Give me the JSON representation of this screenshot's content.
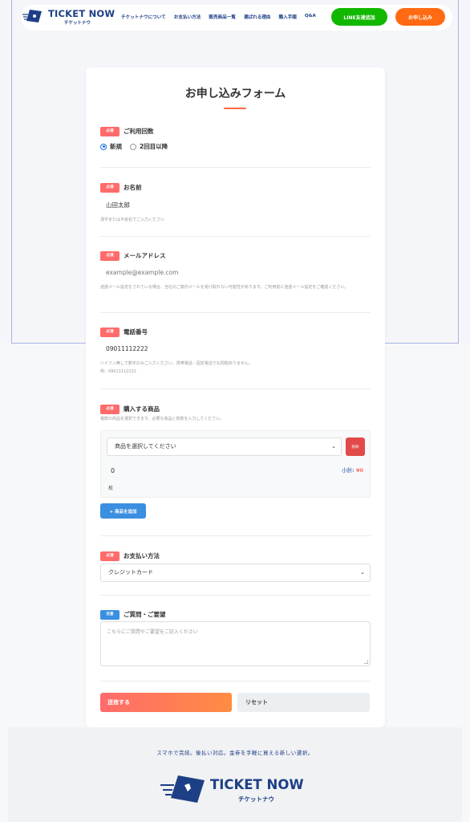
{
  "header": {
    "logo_title": "TICKET NOW",
    "logo_sub": "チケットナウ",
    "nav": [
      "チケットナウについて",
      "お支払い方法",
      "販売商品一覧",
      "選ばれる理由",
      "購入手順",
      "Q&A"
    ],
    "line_button": "LINE友達追加",
    "apply_button": "お申し込み",
    "colors": {
      "navy": "#1d3f86",
      "line": "#12b800",
      "apply": "#ff6a13"
    }
  },
  "form": {
    "title": "お申し込みフォーム",
    "usage": {
      "badge": "必須",
      "label": "ご利用回数",
      "options": [
        "新規",
        "2回目以降"
      ],
      "selected": "新規"
    },
    "name": {
      "badge": "必須",
      "label": "お名前",
      "value": "山田太郎",
      "help": "漢字または平仮名でご入力ください"
    },
    "email": {
      "badge": "必須",
      "label": "メールアドレス",
      "placeholder": "example@example.com",
      "help": "迷惑メール設定をされている場合、当社のご案内メールを受け取れない可能性があります。ご利用前に迷惑メール設定をご確認ください。"
    },
    "phone": {
      "badge": "必須",
      "label": "電話番号",
      "value": "09011112222",
      "help": "ハイフン無しで数字のみご入力ください。携帯電話・固定電話でも問題ありません。",
      "example": "例：09011112222"
    },
    "products": {
      "badge": "必須",
      "label": "購入する商品",
      "help": "複数の商品を選択できます。必要な商品と枚数を入力してください。",
      "select_placeholder": "商品を選択してください",
      "delete_label": "削除",
      "quantity": "0",
      "unit": "枚",
      "subtotal_label": "小計:",
      "subtotal_value": "¥0",
      "add_button": "+ 商品を追加"
    },
    "payment": {
      "badge": "必須",
      "label": "お支払い方法",
      "selected": "クレジットカード"
    },
    "questions": {
      "badge": "任意",
      "label": "ご質問・ご要望",
      "placeholder": "こちらにご質問やご要望をご記入ください"
    },
    "submit_label": "送信する",
    "reset_label": "リセット"
  },
  "footer": {
    "tagline": "スマホで完結。後払い対応。金券を手軽に買える新しい選択。",
    "logo_title": "TICKET NOW",
    "logo_sub": "チケットナウ"
  }
}
